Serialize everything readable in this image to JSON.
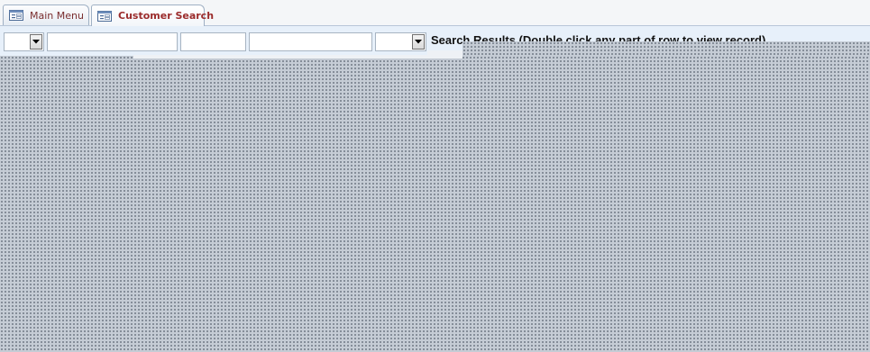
{
  "tabs": [
    {
      "label": "Main Menu",
      "icon": "form-icon",
      "active": false
    },
    {
      "label": "Customer Search",
      "icon": "form-icon",
      "active": true
    }
  ],
  "search": {
    "fields": [
      {
        "type": "combo",
        "value": ""
      },
      {
        "type": "text",
        "value": ""
      },
      {
        "type": "text",
        "value": ""
      },
      {
        "type": "text",
        "value": ""
      },
      {
        "type": "combo",
        "value": ""
      }
    ],
    "results_label": "Search Results (Double click any part of row to view record)"
  },
  "colors": {
    "tab_text": "#9b2b2b",
    "header_bg": "#e7f0fa",
    "grid_bg": "#c5ccd5"
  }
}
